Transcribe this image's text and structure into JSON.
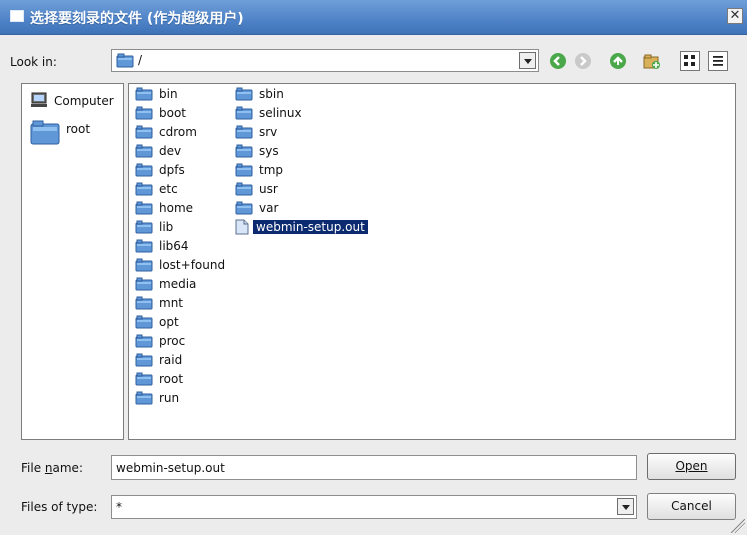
{
  "window": {
    "title": "选择要刻录的文件 (作为超级用户)",
    "close_label": "✕"
  },
  "look_in": {
    "label": "Look in:",
    "path": "/"
  },
  "sidebar": {
    "items": [
      {
        "label": "Computer"
      },
      {
        "label": "root"
      }
    ]
  },
  "files": {
    "column1": [
      "bin",
      "boot",
      "cdrom",
      "dev",
      "dpfs",
      "etc",
      "home",
      "lib",
      "lib64",
      "lost+found",
      "media",
      "mnt",
      "opt",
      "proc",
      "raid",
      "root",
      "run"
    ],
    "column2": [
      "sbin",
      "selinux",
      "srv",
      "sys",
      "tmp",
      "usr",
      "var"
    ],
    "selected": "webmin-setup.out"
  },
  "filename": {
    "label": "File name:",
    "label_mnemonic": "n",
    "value": "webmin-setup.out"
  },
  "filetype": {
    "label": "Files of type:",
    "value": "*"
  },
  "buttons": {
    "open": "Open",
    "cancel": "Cancel"
  },
  "colors": {
    "title_bar": "#4f83c8",
    "selection": "#0b2a6f",
    "folder": "#5f97d7"
  }
}
